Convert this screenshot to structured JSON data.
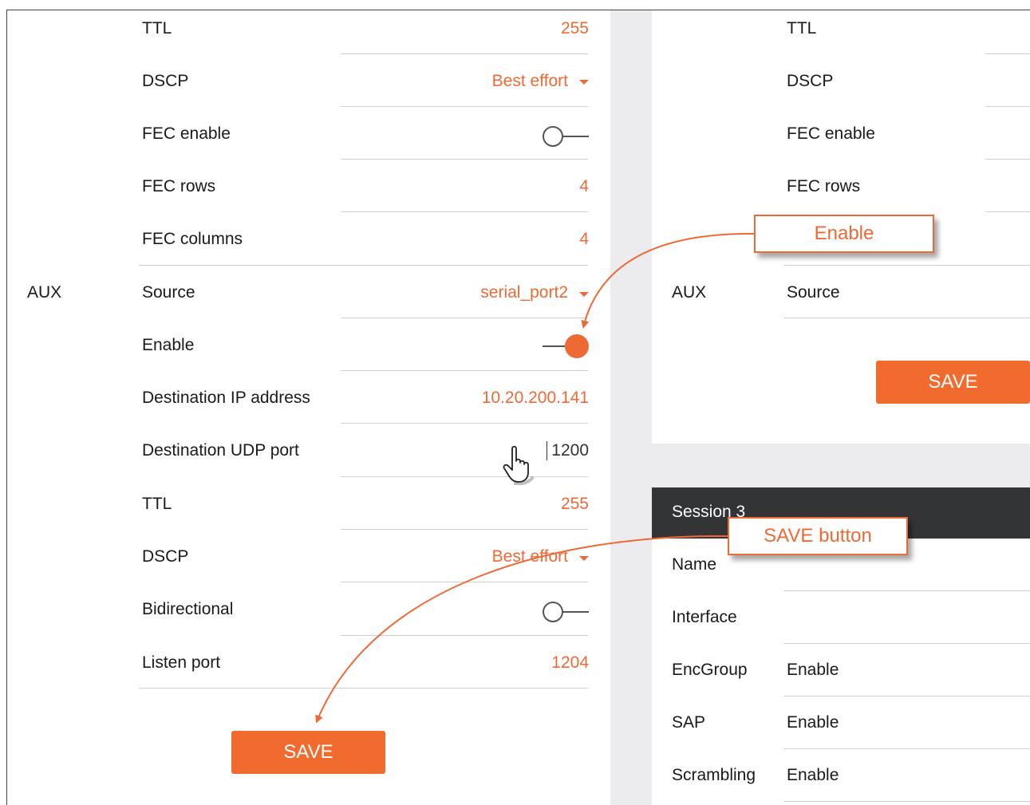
{
  "left_panel": {
    "rows_top": [
      {
        "label": "TTL",
        "value": "255"
      },
      {
        "label": "DSCP",
        "value": "Best effort"
      },
      {
        "label": "FEC enable"
      },
      {
        "label": "FEC rows",
        "value": "4"
      },
      {
        "label": "FEC columns",
        "value": "4"
      }
    ],
    "aux_section_label": "AUX",
    "rows_aux": [
      {
        "label": "Source",
        "value": "serial_port2"
      },
      {
        "label": "Enable"
      },
      {
        "label": "Destination IP address",
        "value": "10.20.200.141"
      },
      {
        "label": "Destination UDP port",
        "value": "1200"
      },
      {
        "label": "TTL",
        "value": "255"
      },
      {
        "label": "DSCP",
        "value": "Best effort"
      },
      {
        "label": "Bidirectional"
      },
      {
        "label": "Listen port",
        "value": "1204"
      }
    ],
    "fec_enable_state": "off",
    "aux_enable_state": "on",
    "bidirectional_state": "off",
    "save_label": "SAVE"
  },
  "right_panel": {
    "rows_top": [
      "TTL",
      "DSCP",
      "FEC enable",
      "FEC rows"
    ],
    "aux_section_label": "AUX",
    "aux_source_label": "Source",
    "save_label": "SAVE",
    "session_title": "Session 3",
    "session_rows": [
      {
        "label": "Name",
        "value": ""
      },
      {
        "label": "Interface",
        "value": ""
      },
      {
        "label": "EncGroup",
        "value": "Enable"
      },
      {
        "label": "SAP",
        "value": "Enable"
      },
      {
        "label": "Scrambling",
        "value": "Enable"
      }
    ]
  },
  "callouts": {
    "enable": "Enable",
    "save_button": "SAVE button"
  },
  "colors": {
    "accent": "#ee6a35",
    "session_bar": "#333436",
    "separator": "#ecebee"
  }
}
